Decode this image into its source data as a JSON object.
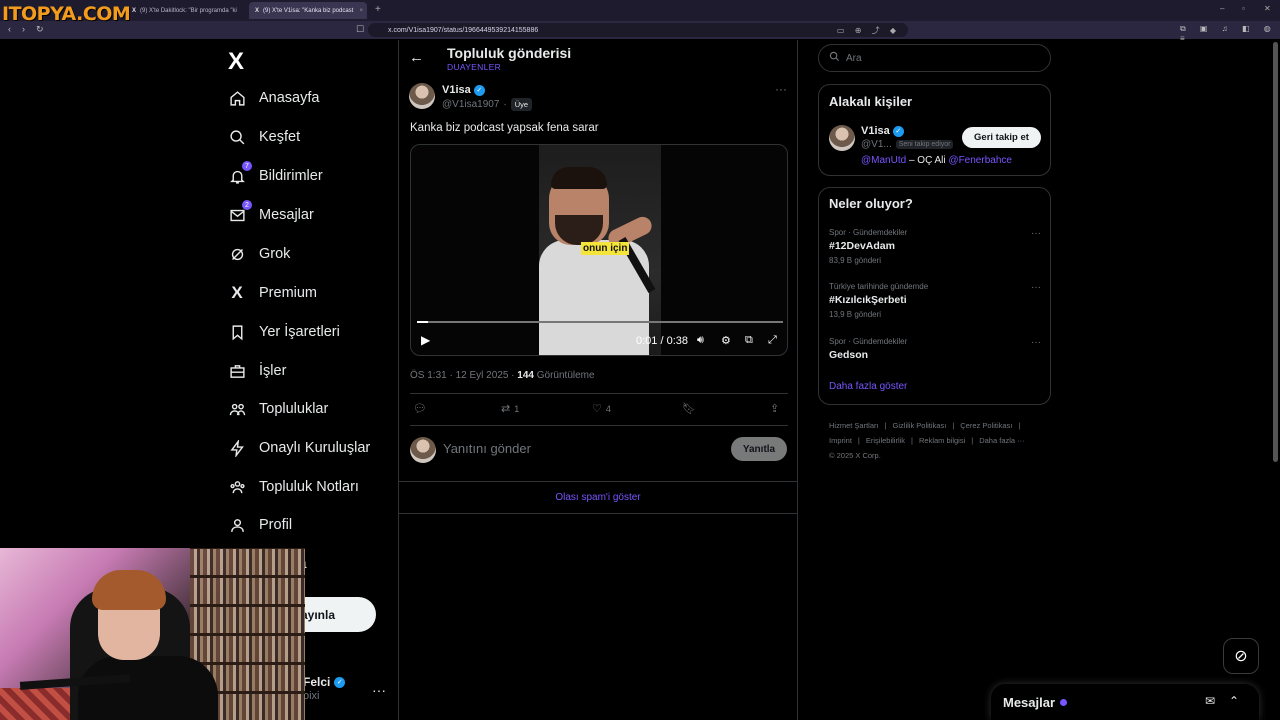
{
  "watermark": "ITOPYA.COM",
  "browser": {
    "tabs": [
      {
        "label": "(9) X'te Dakitlock: \"Bir programda \"ki"
      },
      {
        "label": "(9) X'te V1isa: \"Kanka biz podcast"
      }
    ],
    "url": "x.com/V1isa1907/status/1966449539214155886",
    "new_tab": "+"
  },
  "sidebar": {
    "logo": "X",
    "items": [
      {
        "label": "Anasayfa",
        "icon": "home-icon"
      },
      {
        "label": "Keşfet",
        "icon": "search-icon"
      },
      {
        "label": "Bildirimler",
        "icon": "bell-icon",
        "badge": "7"
      },
      {
        "label": "Mesajlar",
        "icon": "mail-icon",
        "badge": "2"
      },
      {
        "label": "Grok",
        "icon": "grok-icon"
      },
      {
        "label": "Premium",
        "icon": "x-icon"
      },
      {
        "label": "Yer İşaretleri",
        "icon": "bookmark-icon"
      },
      {
        "label": "İşler",
        "icon": "briefcase-icon"
      },
      {
        "label": "Topluluklar",
        "icon": "communities-icon"
      },
      {
        "label": "Onaylı Kuruluşlar",
        "icon": "lightning-icon"
      },
      {
        "label": "Topluluk Notları",
        "icon": "notes-icon"
      },
      {
        "label": "Profil",
        "icon": "person-icon"
      },
      {
        "label": "zla",
        "icon": "more-icon"
      }
    ],
    "post_button": "ayınla",
    "profile": {
      "name": "Felci",
      "handle": "oixi"
    }
  },
  "main": {
    "title": "Topluluk gönderisi",
    "subtitle": "DUAYENLER",
    "tweet": {
      "name": "V1isa",
      "handle": "@V1isa1907",
      "member_badge": "Üye",
      "text": "Kanka biz podcast yapsak fena sarar",
      "video": {
        "caption": "onun için",
        "time": "0:01 / 0:38",
        "progress": 0.03
      },
      "meta_time": "ÖS 1:31 · 12 Eyl 2025 · ",
      "views_count": "144",
      "views_label": " Görüntüleme",
      "actions": {
        "reply": "",
        "retweet": "1",
        "like": "4"
      }
    },
    "reply": {
      "placeholder": "Yanıtını gönder",
      "button": "Yanıtla"
    },
    "spam_link": "Olası spam'i göster"
  },
  "right": {
    "search_placeholder": "Ara",
    "relevant": {
      "title": "Alakalı kişiler",
      "name": "V1isa",
      "handle": "@V1...",
      "follows_you": "Seni takip ediyor",
      "follow_back": "Geri takip et",
      "bio_link1": "@ManUtd",
      "bio_mid": " – OÇ Ali ",
      "bio_link2": "@Fenerbahce"
    },
    "trends": {
      "title": "Neler oluyor?",
      "items": [
        {
          "context": "Spor · Gündemdekiler",
          "topic": "#12DevAdam",
          "count": "83,9 B gönderi"
        },
        {
          "context": "Türkiye tarihinde gündemde",
          "topic": "#KızılcıkŞerbeti",
          "count": "13,9 B gönderi"
        },
        {
          "context": "Spor · Gündemdekiler",
          "topic": "Gedson",
          "count": ""
        }
      ],
      "show_more": "Daha fazla göster"
    },
    "footer": {
      "links": [
        "Hizmet Şartları",
        "|",
        "Gizlilik Politikası",
        "|",
        "Çerez Politikası",
        "|",
        "Imprint",
        "|",
        "Erişilebilirlik",
        "|",
        "Reklam bilgisi",
        "|",
        "Daha fazla ···"
      ],
      "copyright": "© 2025 X Corp."
    }
  },
  "messages_drawer": {
    "title": "Mesajlar"
  },
  "colors": {
    "accent": "#7856ff",
    "verified": "#1d9bf0",
    "background": "#000000"
  }
}
